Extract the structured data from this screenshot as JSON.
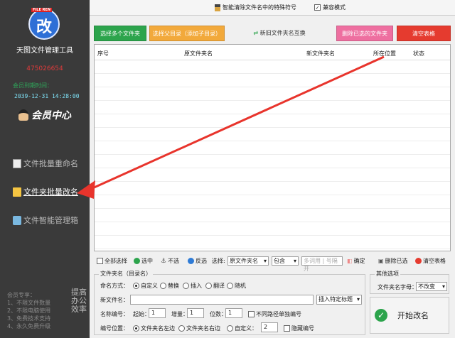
{
  "sidebar": {
    "logo_badge": "FILE REN",
    "logo_glyph": "改",
    "app_title": "天图文件管理工具",
    "qq": "475026654",
    "expiry_label": "会员到期时间：",
    "expiry_date": "2039-12-31 14:28:00",
    "member_center": "会员中心",
    "nav": [
      {
        "label": "文件批量重命名",
        "icon": "document-icon"
      },
      {
        "label": "文件夹批量改名",
        "icon": "folder-icon"
      },
      {
        "label": "文件智能管理箱",
        "icon": "toolbox-icon"
      }
    ],
    "promo_lines": [
      "会员专享：",
      "1、不限文件数量",
      "2、不限电脑使用",
      "3、免费技术支持",
      "4、永久免费升级"
    ],
    "promo_vertical": "提高办公效率"
  },
  "topbar": {
    "special_chars": "智能清除文件名中的特殊符号",
    "compat_mode": "兼容模式",
    "compat_checked": "✓"
  },
  "toolbar": {
    "select_multi": "选择多个文件夹",
    "select_parent": "选择父目录（添加子目录）",
    "swap_names": "新旧文件夹名互换",
    "delete_selected": "删除已选的文件夹",
    "clear_table": "清空表格"
  },
  "table": {
    "headers": [
      "序号",
      "原文件夹名",
      "新文件夹名",
      "所在位置",
      "状态"
    ]
  },
  "selection": {
    "select_all": "全部选择",
    "select": "选中",
    "unselect": "不选",
    "invert": "反选",
    "choose_label": "选择:",
    "choose_field": "原文件夹名",
    "match_mode": "包含",
    "keyword_placeholder": "多词用 | 号隔开",
    "confirm": "确定",
    "delete_selected": "删除已选",
    "clear_table": "清空表格"
  },
  "rename_group": {
    "title": "文件夹名（目录名）",
    "mode_label": "命名方式：",
    "modes": [
      "自定义",
      "替换",
      "插入",
      "翻译",
      "随机"
    ],
    "new_name_label": "新文件名：",
    "insert_title_select": "插入特定标题",
    "numbering_label": "名称编号：",
    "start_label": "起始：",
    "start_value": "1",
    "step_label": "增量：",
    "step_value": "1",
    "digits_label": "位数：",
    "digits_value": "1",
    "separate_numbering": "不同路径单独编号",
    "position_label": "编号位置：",
    "positions": [
      "文件夹名左边",
      "文件夹名右边",
      "自定义："
    ],
    "custom_position_value": "2",
    "hide_numbering": "隐藏编号"
  },
  "other_options": {
    "title": "其他选项",
    "case_label": "文件夹名字母：",
    "case_value": "不改变"
  },
  "start_button": "开始改名",
  "colors": {
    "sidebar_bg": "#3a3a3a",
    "green": "#2ca44c",
    "orange": "#f2a93b",
    "pink": "#ee6fa0",
    "red": "#e53b2f",
    "arrow": "#e8342c"
  }
}
